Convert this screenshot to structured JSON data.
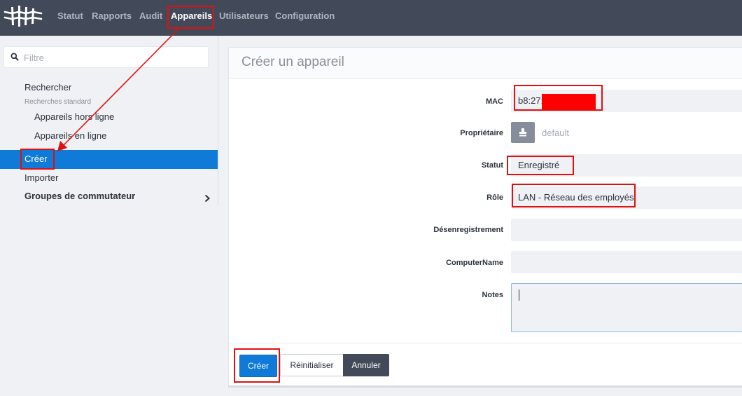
{
  "topnav": {
    "items": [
      "Statut",
      "Rapports",
      "Audit",
      "Appareils",
      "Utilisateurs",
      "Configuration"
    ],
    "active": "Appareils"
  },
  "sidebar": {
    "filter_placeholder": "Filtre",
    "search": "Rechercher",
    "standard_searches_label": "Recherches standard",
    "offline": "Appareils hors ligne",
    "online": "Appareils en ligne",
    "create": "Créer",
    "import": "Importer",
    "switch_groups": "Groupes de commutateur"
  },
  "form": {
    "title": "Créer un appareil",
    "labels": {
      "mac": "MAC",
      "owner": "Propriétaire",
      "status": "Statut",
      "role": "Rôle",
      "unregistration": "Désenregistrement",
      "computer_name": "ComputerName",
      "notes": "Notes"
    },
    "values": {
      "mac": "b8:27:",
      "owner_placeholder": "default",
      "status": "Enregistré",
      "role": "LAN - Réseau des employés"
    }
  },
  "buttons": {
    "create": "Créer",
    "reset": "Réinitialiser",
    "cancel": "Annuler"
  },
  "colors": {
    "topbar": "#424a59",
    "accent": "#0f7ad7",
    "annotation": "#e01010"
  }
}
